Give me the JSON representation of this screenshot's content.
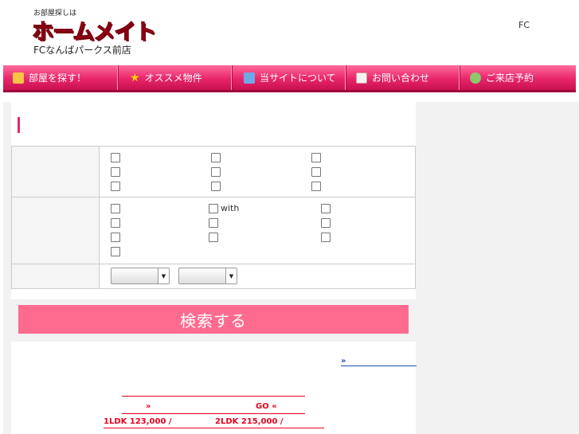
{
  "header": {
    "logo_small": "お部屋探しは",
    "logo_main": "ホームメイト",
    "logo_sub": "FCなんばパークス前店",
    "right_text": "FC"
  },
  "nav": {
    "items": [
      {
        "label": "部屋を探す！",
        "icon": "house-icon",
        "color": "#f6c544"
      },
      {
        "label": "オススメ物件",
        "icon": "star-icon",
        "color": "#ffd400"
      },
      {
        "label": "当サイトについて",
        "icon": "info-icon",
        "color": "#6fa8e6"
      },
      {
        "label": "お問い合わせ",
        "icon": "mail-icon",
        "color": "#f2f2f2"
      },
      {
        "label": "ご来店予約",
        "icon": "people-icon",
        "color": "#8cc86a"
      }
    ]
  },
  "search": {
    "option_with_label": "with",
    "submit_label": "検索する"
  },
  "links": {
    "more": "»"
  },
  "promo": {
    "arrow_left": "»",
    "go_label": "GO «",
    "price_1ldk": "1LDK 123,000 /",
    "price_2ldk": "2LDK 215,000 /"
  },
  "colors": {
    "accent": "#e8266a",
    "button": "#ff6b8f",
    "link": "#1a4fbf",
    "promo": "#e8001f"
  }
}
